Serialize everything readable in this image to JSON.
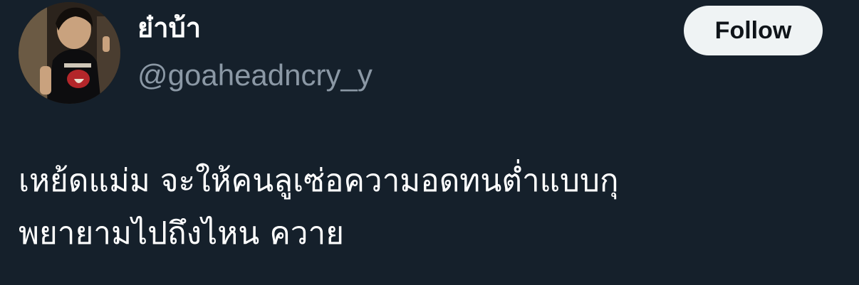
{
  "user": {
    "display_name": "ย๋าบ้า",
    "username": "@goaheadncry_y"
  },
  "follow_button": {
    "label": "Follow"
  },
  "tweet": {
    "lines": [
      "เหย้ดแม่ม จะให้คนลูเซ่อความอดทนต่ำแบบกุ",
      "พยายามไปถึงไหน ควาย"
    ]
  },
  "colors": {
    "background": "#15202b",
    "text_primary": "#ffffff",
    "text_secondary": "#8b98a5",
    "button_bg": "#eff3f4",
    "button_text": "#0f1419"
  }
}
